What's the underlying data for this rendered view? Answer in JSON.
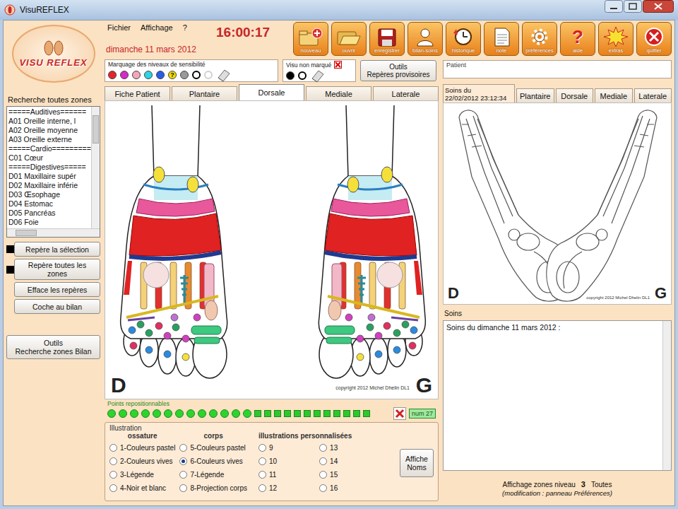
{
  "window": {
    "title": "VisuREFLEX"
  },
  "logo": {
    "text": "VISU REFLEX"
  },
  "menu": [
    "Fichier",
    "Affichage",
    "?"
  ],
  "clock": {
    "time": "16:00:17",
    "date": "dimanche 11 mars 2012"
  },
  "toolbar": [
    {
      "label": "nouveau",
      "kind": "new"
    },
    {
      "label": "ouvrir",
      "kind": "open"
    },
    {
      "label": "enregistrer",
      "kind": "save"
    },
    {
      "label": "bilan-soins",
      "kind": "person"
    },
    {
      "label": "historique",
      "kind": "history"
    },
    {
      "label": "note",
      "kind": "note"
    },
    {
      "label": "préférences",
      "kind": "gear"
    },
    {
      "label": "aide",
      "kind": "help",
      "glyph": "?"
    },
    {
      "label": "extras",
      "kind": "star"
    },
    {
      "label": "quitter",
      "kind": "quit"
    }
  ],
  "search": {
    "label": "Recherche toutes zones",
    "items": [
      {
        "text": "=====Auditives======",
        "selected": false
      },
      {
        "text": "A01 Oreille interne, l",
        "selected": false
      },
      {
        "text": "A02 Oreille moyenne",
        "selected": false
      },
      {
        "text": "A03 Oreille externe",
        "selected": false
      },
      {
        "text": "=====Cardio=========",
        "selected": false
      },
      {
        "text": "C01 Cœur",
        "selected": false
      },
      {
        "text": "=====Digestives=====",
        "selected": false
      },
      {
        "text": "D01 Maxillaire supér",
        "selected": false
      },
      {
        "text": "D02 Maxillaire inférie",
        "selected": false
      },
      {
        "text": "D03 Œsophage",
        "selected": false
      },
      {
        "text": "D04 Estomac",
        "selected": false
      },
      {
        "text": "D05 Pancréas",
        "selected": false
      },
      {
        "text": "D06 Foie",
        "selected": false
      }
    ]
  },
  "left_buttons": [
    {
      "label": "Repère la sélection",
      "kind": "swatch"
    },
    {
      "label": "Repère toutes les zones",
      "kind": "swatch"
    },
    {
      "label": "Efface les repères",
      "kind": "plain"
    },
    {
      "label": "Coche au bilan",
      "kind": "plain"
    }
  ],
  "tools_button": {
    "lines": [
      "Outils",
      "Recherche zones Bilan"
    ]
  },
  "sensitivity": {
    "label": "Marquage des niveaux de sensibilité",
    "levels": [
      {
        "kind": "dot",
        "color": "#e3262b"
      },
      {
        "kind": "dot",
        "color": "#d62ac8"
      },
      {
        "kind": "dot",
        "color": "#f2a7b8"
      },
      {
        "kind": "dot",
        "color": "#2fd3e3"
      },
      {
        "kind": "dot",
        "color": "#2a5ee8"
      },
      {
        "kind": "dot",
        "color": "#f2e000",
        "text": "?"
      },
      {
        "kind": "dot",
        "color": "#9a9a9a"
      },
      {
        "kind": "ring",
        "color": "#000000"
      },
      {
        "kind": "ring",
        "color": "#d0d0d0"
      }
    ]
  },
  "visu": {
    "label": "Visu non marqué",
    "levels": [
      {
        "kind": "dot",
        "color": "#000000"
      },
      {
        "kind": "ring",
        "color": "#000000"
      }
    ]
  },
  "tmp_button": {
    "lines": [
      "Outils",
      "Repères provisoires"
    ]
  },
  "patient": {
    "label": "Patient"
  },
  "tabs": [
    {
      "label": "Fiche Patient",
      "selected": false
    },
    {
      "label": "Plantaire",
      "selected": false
    },
    {
      "label": "Dorsale",
      "selected": true
    },
    {
      "label": "Mediale",
      "selected": false
    },
    {
      "label": "Laterale",
      "selected": false
    }
  ],
  "feet": {
    "right": "D",
    "left": "G",
    "copyright": "copyright 2012 Michel Dhelin DL1"
  },
  "points": {
    "label": "Points repositionnables",
    "count": "num 27",
    "items": [
      {
        "kind": "circle"
      },
      {
        "kind": "circle"
      },
      {
        "kind": "circle"
      },
      {
        "kind": "circle"
      },
      {
        "kind": "circle"
      },
      {
        "kind": "circle"
      },
      {
        "kind": "circle"
      },
      {
        "kind": "circle"
      },
      {
        "kind": "circle"
      },
      {
        "kind": "circle"
      },
      {
        "kind": "circle"
      },
      {
        "kind": "circle"
      },
      {
        "kind": "circle"
      },
      {
        "kind": "square"
      },
      {
        "kind": "square"
      },
      {
        "kind": "square"
      },
      {
        "kind": "square"
      },
      {
        "kind": "square"
      },
      {
        "kind": "square"
      },
      {
        "kind": "square"
      },
      {
        "kind": "square"
      },
      {
        "kind": "square"
      },
      {
        "kind": "square"
      },
      {
        "kind": "square"
      },
      {
        "kind": "square"
      }
    ]
  },
  "illustration": {
    "title": "Illustration",
    "button": {
      "lines": [
        "Affiche",
        "Noms"
      ]
    },
    "groups": [
      {
        "heading": "ossature",
        "options": [
          {
            "label": "1-Couleurs pastel",
            "selected": false
          },
          {
            "label": "2-Couleurs vives",
            "selected": false
          },
          {
            "label": "3-Légende",
            "selected": false
          },
          {
            "label": "4-Noir et blanc",
            "selected": false
          }
        ]
      },
      {
        "heading": "corps",
        "options": [
          {
            "label": "5-Couleurs pastel",
            "selected": false
          },
          {
            "label": "6-Couleurs vives",
            "selected": true
          },
          {
            "label": "7-Légende",
            "selected": false
          },
          {
            "label": "8-Projection corps",
            "selected": false
          }
        ]
      },
      {
        "heading": "illustrations personnalisées",
        "options": [
          {
            "label": "9",
            "selected": false
          },
          {
            "label": "10",
            "selected": false
          },
          {
            "label": "11",
            "selected": false
          },
          {
            "label": "12",
            "selected": false
          },
          {
            "label": "13",
            "selected": false
          },
          {
            "label": "14",
            "selected": false
          },
          {
            "label": "15",
            "selected": false
          },
          {
            "label": "16",
            "selected": false
          }
        ]
      }
    ]
  },
  "history_view": {
    "tabs": [
      {
        "lines": [
          "Soins du",
          "22/02/2012 23:12:34"
        ],
        "selected": true
      },
      {
        "lines": [
          "Plantaire"
        ],
        "selected": false
      },
      {
        "lines": [
          "Dorsale"
        ],
        "selected": false
      },
      {
        "lines": [
          "Mediale"
        ],
        "selected": false
      },
      {
        "lines": [
          "Laterale"
        ],
        "selected": false
      }
    ],
    "right": "D",
    "left": "G",
    "copyright": "copyright 2012 Michel Dhelin DL1"
  },
  "soins": {
    "label": "Soins",
    "text": "Soins du dimanche 11 mars 2012 :"
  },
  "footer": {
    "label": "Affichage zones niveau",
    "level": "3",
    "scope": "Toutes",
    "note": "(modification : panneau Préférences)"
  }
}
